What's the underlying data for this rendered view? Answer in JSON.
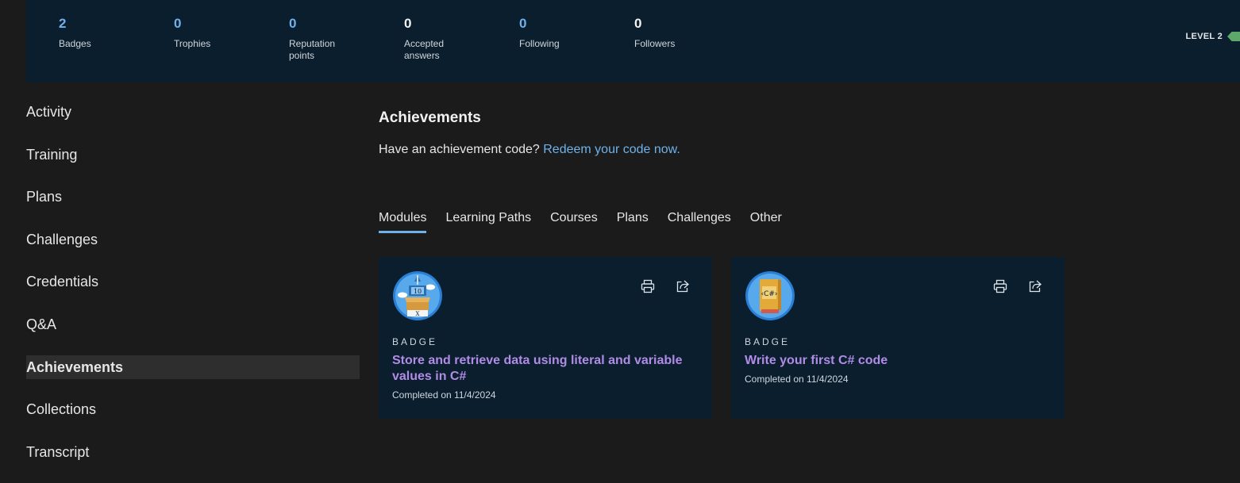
{
  "stats": [
    {
      "value": "2",
      "label": "Badges",
      "color": "#6fb2ea"
    },
    {
      "value": "0",
      "label": "Trophies",
      "color": "#6fb2ea"
    },
    {
      "value": "0",
      "label": "Reputation\npoints",
      "color": "#6fb2ea"
    },
    {
      "value": "0",
      "label": "Accepted\nanswers",
      "color": "#f2f2f2"
    },
    {
      "value": "0",
      "label": "Following",
      "color": "#6fb2ea"
    },
    {
      "value": "0",
      "label": "Followers",
      "color": "#f2f2f2"
    }
  ],
  "level": {
    "label": "LEVEL 2",
    "color": "#5fa86b"
  },
  "sidebar": {
    "items": [
      {
        "label": "Activity",
        "active": false
      },
      {
        "label": "Training",
        "active": false
      },
      {
        "label": "Plans",
        "active": false
      },
      {
        "label": "Challenges",
        "active": false
      },
      {
        "label": "Credentials",
        "active": false
      },
      {
        "label": "Q&A",
        "active": false
      },
      {
        "label": "Achievements",
        "active": true
      },
      {
        "label": "Collections",
        "active": false
      },
      {
        "label": "Transcript",
        "active": false
      }
    ]
  },
  "main": {
    "title": "Achievements",
    "redeem_prompt": "Have an achievement code?",
    "redeem_link": "Redeem your code now.",
    "tabs": [
      {
        "label": "Modules",
        "active": true
      },
      {
        "label": "Learning Paths",
        "active": false
      },
      {
        "label": "Courses",
        "active": false
      },
      {
        "label": "Plans",
        "active": false
      },
      {
        "label": "Challenges",
        "active": false
      },
      {
        "label": "Other",
        "active": false
      }
    ],
    "cards": [
      {
        "type": "BADGE",
        "title": "Store and retrieve data using literal and variable values in C#",
        "completed": "Completed on 11/4/2024",
        "badge_icon": "variables-box-badge-icon",
        "print_icon": "print-icon",
        "share_icon": "share-icon"
      },
      {
        "type": "BADGE",
        "title": "Write your first C# code",
        "completed": "Completed on 11/4/2024",
        "badge_icon": "csharp-book-badge-icon",
        "print_icon": "print-icon",
        "share_icon": "share-icon"
      }
    ]
  },
  "colors": {
    "accent": "#6fb2ea",
    "card_title": "#b18ce6",
    "panel": "#0a1e2e"
  }
}
